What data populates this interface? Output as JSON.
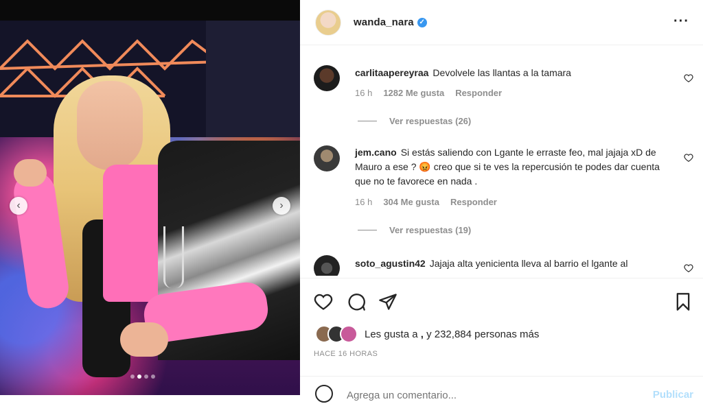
{
  "post": {
    "username": "wanda_nara",
    "verified_icon": "verified-badge-icon",
    "more_icon": "more-options-icon"
  },
  "comments": [
    {
      "user": "carlitaapereyraa",
      "text": "Devolvele las llantas a la tamara",
      "time": "16 h",
      "likes": "1282 Me gusta",
      "reply": "Responder",
      "replies": "Ver respuestas (26)"
    },
    {
      "user": "jem.cano",
      "text": "Si estás saliendo con Lgante le erraste feo, mal jajaja xD de Mauro a ese ? 😡 creo que si te ves la repercusión te podes dar cuenta que no te favorece en nada .",
      "time": "16 h",
      "likes": "304 Me gusta",
      "reply": "Responder",
      "replies": "Ver respuestas (19)"
    },
    {
      "user": "soto_agustin42",
      "text": "Jajaja alta yenicienta lleva al barrio el lgante al"
    }
  ],
  "likes": {
    "prefix": "Les gusta a",
    "user": " ,",
    "suffix": "y 232,884 personas más"
  },
  "timestamp": "HACE 16 HORAS",
  "add_comment": {
    "placeholder": "Agrega un comentario...",
    "publish": "Publicar"
  },
  "colors": {
    "verified": "#3897f0",
    "muted": "#8e8e8e",
    "publish_disabled": "#b2dffc",
    "pink_top": "#ff6fb8"
  }
}
